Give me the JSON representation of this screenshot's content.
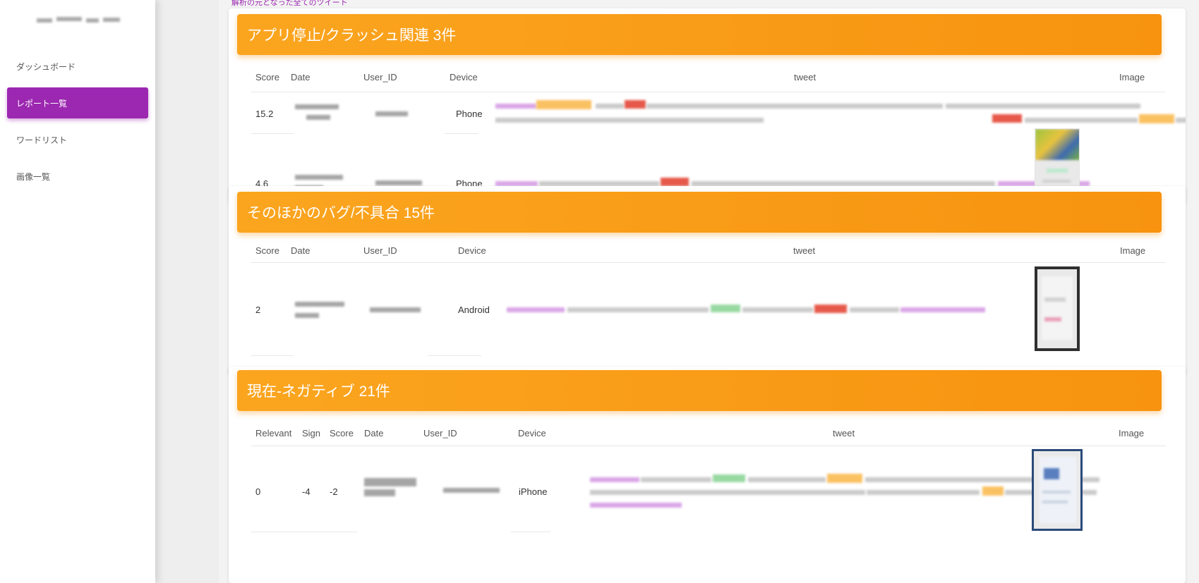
{
  "sidebar": {
    "items": [
      {
        "label": "ダッシュボード",
        "active": false
      },
      {
        "label": "レポート一覧",
        "active": true
      },
      {
        "label": "ワードリスト",
        "active": false
      },
      {
        "label": "画像一覧",
        "active": false
      }
    ]
  },
  "main": {
    "top_link": "解析の元となった全てのツイート",
    "sections": [
      {
        "title": "アプリ停止/クラッシュ関連 3件",
        "columns": [
          "Score",
          "Date",
          "User_ID",
          "Device",
          "tweet",
          "Image"
        ],
        "rows": [
          {
            "score": "15.2",
            "device": "Phone"
          },
          {
            "score": "4.6",
            "device": "Phone"
          }
        ]
      },
      {
        "title": "そのほかのバグ/不具合 15件",
        "columns": [
          "Score",
          "Date",
          "User_ID",
          "Device",
          "tweet",
          "Image"
        ],
        "rows": [
          {
            "score": "2",
            "device": "Android"
          }
        ]
      },
      {
        "title": "現在-ネガティブ 21件",
        "columns": [
          "Relevant",
          "Sign",
          "Score",
          "Date",
          "User_ID",
          "Device",
          "tweet",
          "Image"
        ],
        "rows": [
          {
            "relevant": "0",
            "sign": "-4",
            "score": "-2",
            "device": "iPhone"
          }
        ]
      }
    ]
  },
  "colors": {
    "accent": "#9c27b0",
    "header_orange": "#f7930f",
    "highlight_red": "#e0301e",
    "highlight_green": "#7fcf8a"
  }
}
